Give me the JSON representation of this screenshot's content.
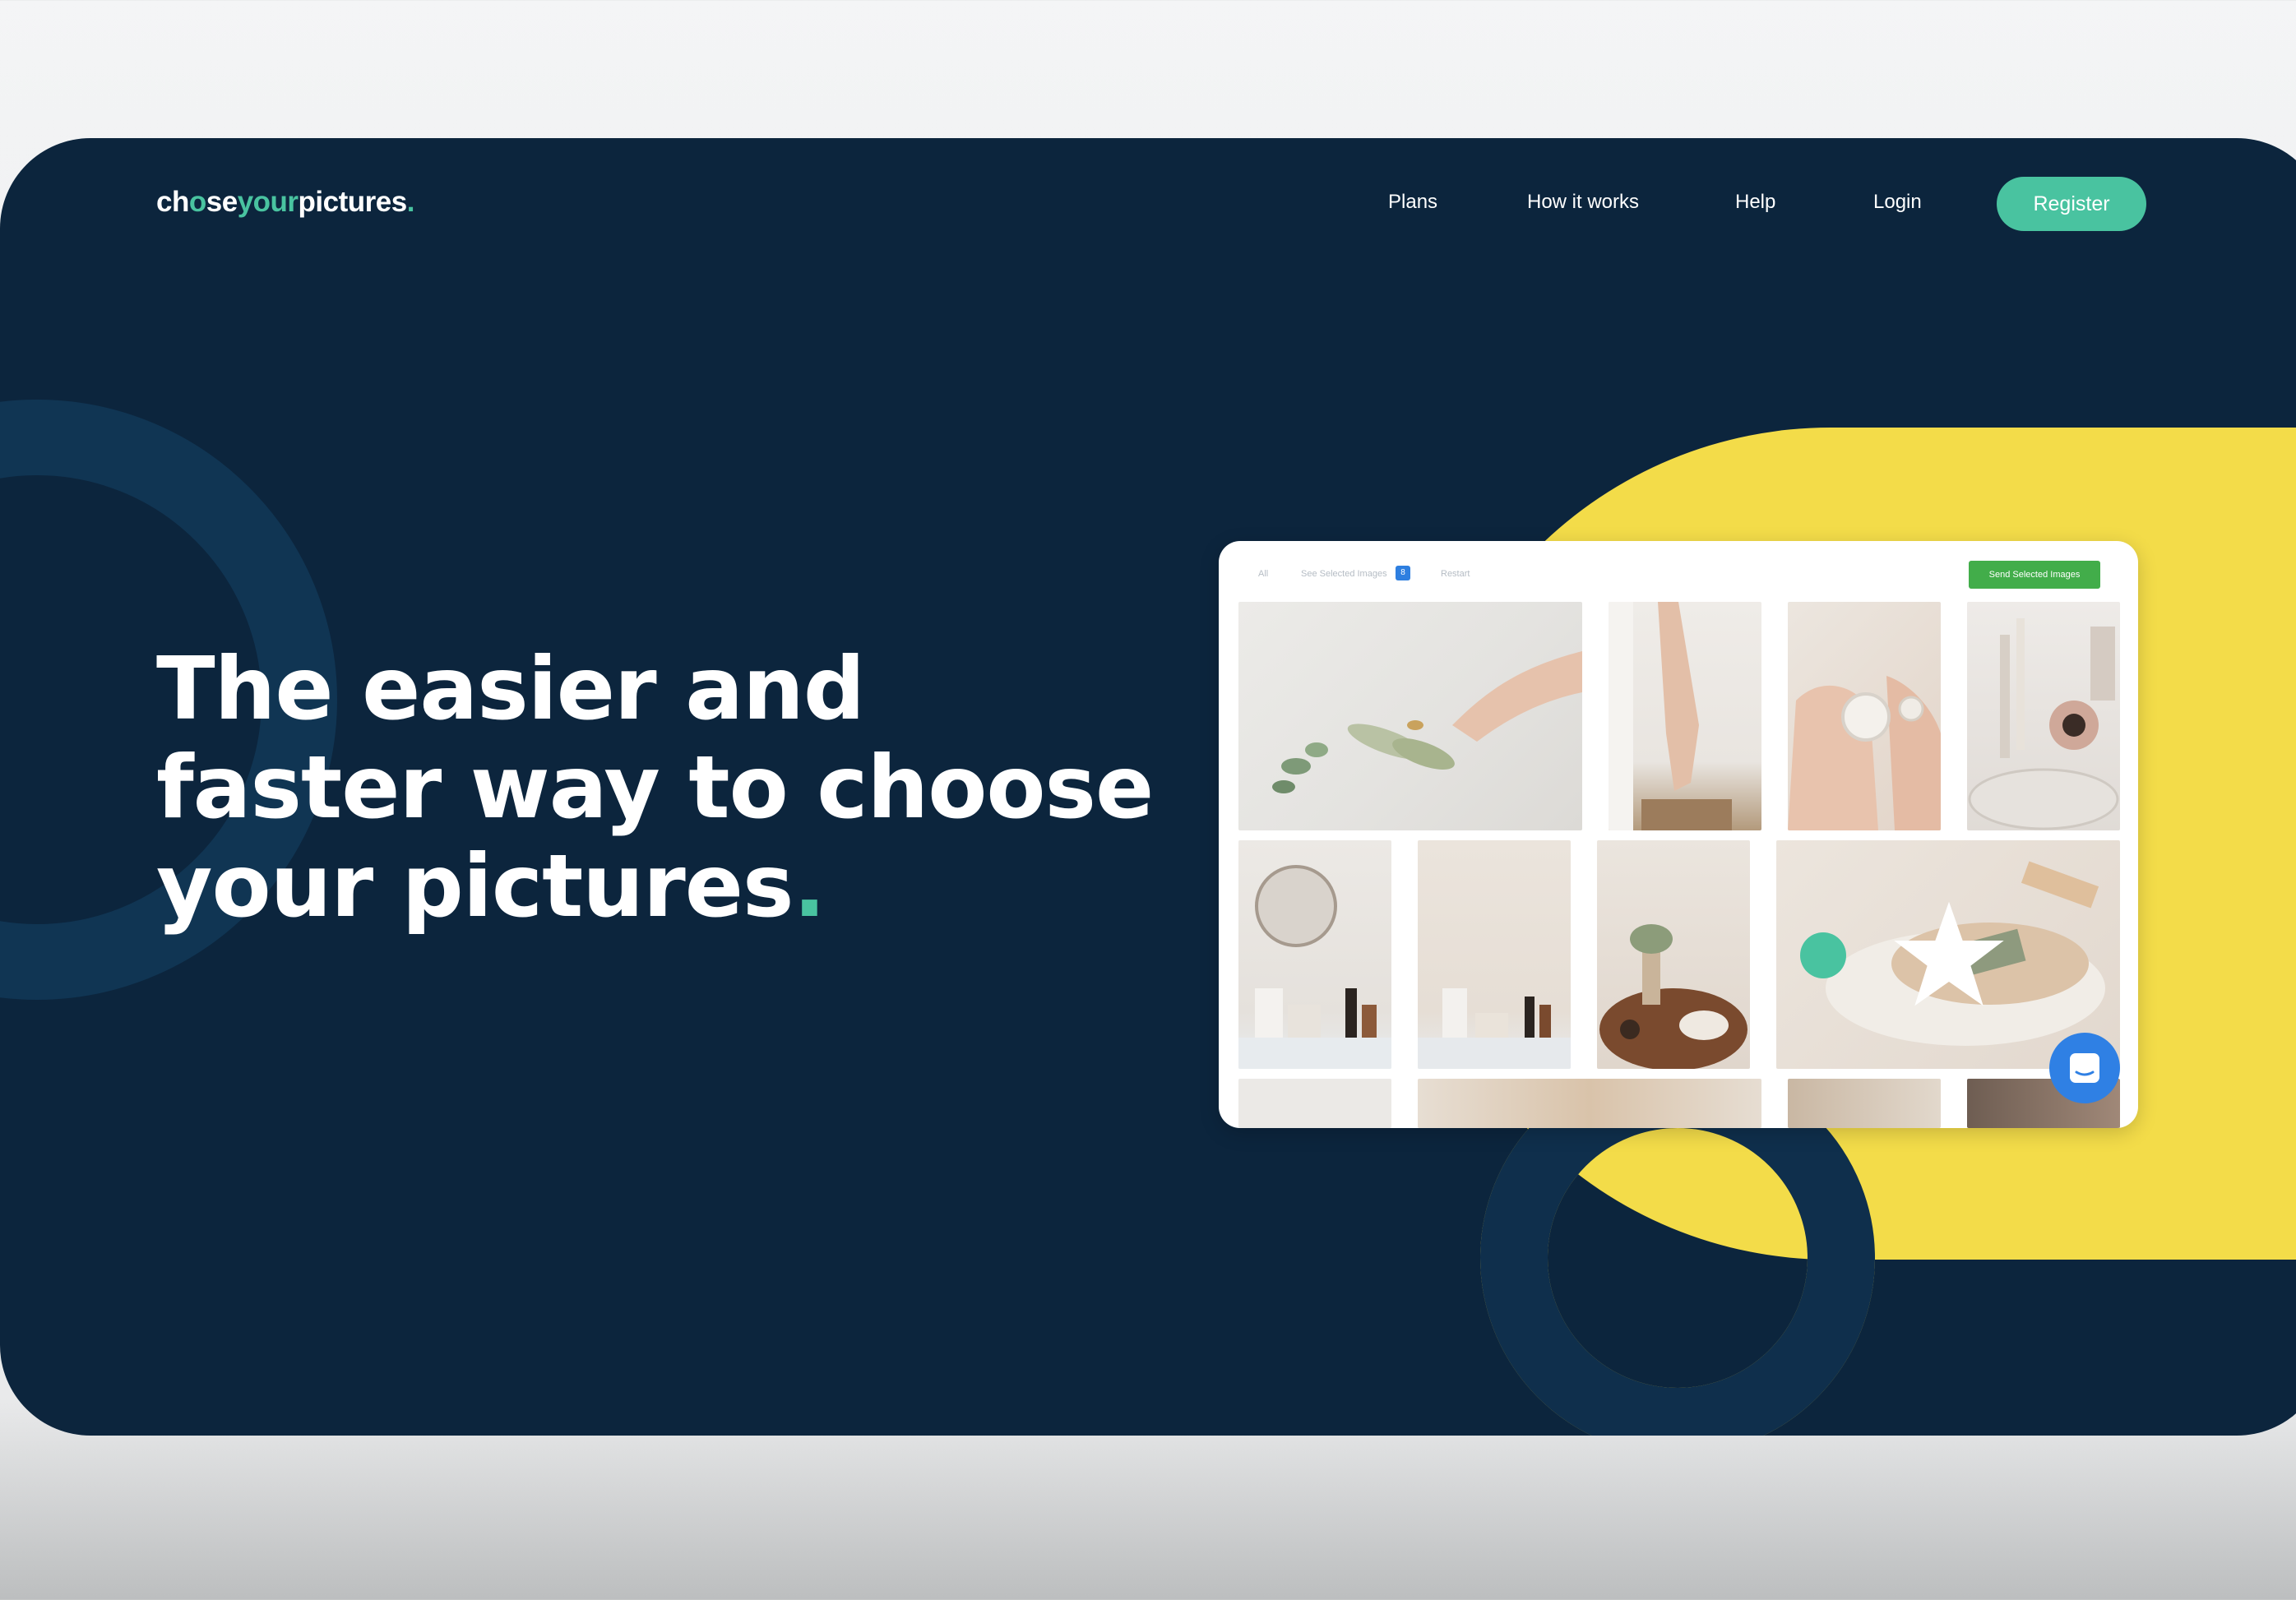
{
  "brand": {
    "logo_parts": [
      "ch",
      "o",
      "se",
      "your",
      "pictures",
      "."
    ],
    "accent": "#49c3a0",
    "navy": "#0c253d",
    "yellow": "#f3dc49"
  },
  "nav": {
    "items": [
      {
        "label": "Plans"
      },
      {
        "label": "How it works"
      },
      {
        "label": "Help"
      },
      {
        "label": "Login"
      }
    ],
    "register_label": "Register"
  },
  "hero": {
    "headline_lines": [
      "The easier and",
      "faster way to choose",
      "your pictures"
    ],
    "headline_dot": "."
  },
  "mockup": {
    "tabs": [
      "All",
      "See Selected Images",
      "Restart"
    ],
    "selected_count": "8",
    "send_button_label": "Send Selected Images",
    "icons": [
      "star-icon",
      "chat-icon"
    ]
  }
}
